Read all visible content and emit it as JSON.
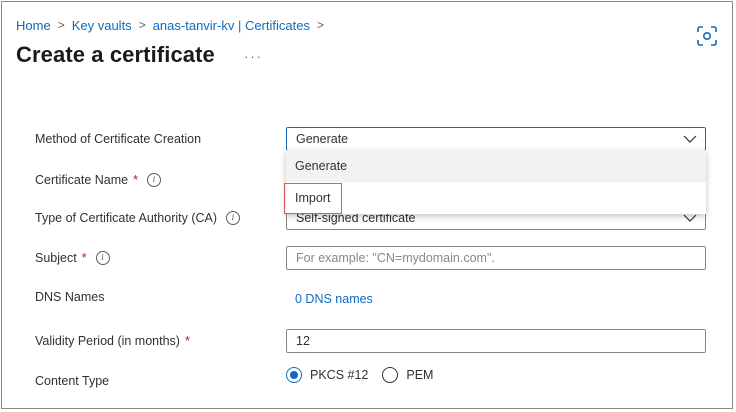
{
  "breadcrumb": {
    "items": [
      "Home",
      "Key vaults",
      "anas-tanvir-kv | Certificates"
    ],
    "separator": ">"
  },
  "header": {
    "title": "Create a certificate",
    "more": "···"
  },
  "form": {
    "method": {
      "label": "Method of Certificate Creation",
      "value": "Generate"
    },
    "dropdown_options": [
      "Generate",
      "Import"
    ],
    "cert_name": {
      "label": "Certificate Name",
      "required": "*",
      "info": "i"
    },
    "ca_type": {
      "label": "Type of Certificate Authority (CA)",
      "info": "i",
      "value": "Self-signed certificate"
    },
    "subject": {
      "label": "Subject",
      "required": "*",
      "info": "i",
      "placeholder": "For example: \"CN=mydomain.com\"."
    },
    "dns": {
      "label": "DNS Names",
      "link": "0 DNS names"
    },
    "validity": {
      "label": "Validity Period (in months)",
      "required": "*",
      "value": "12"
    },
    "content_type": {
      "label": "Content Type",
      "options": [
        "PKCS #12",
        "PEM"
      ],
      "selected": "PKCS #12"
    }
  },
  "colors": {
    "accent": "#0f6cbd",
    "required": "#a4262c",
    "highlight": "#e05a5a"
  }
}
